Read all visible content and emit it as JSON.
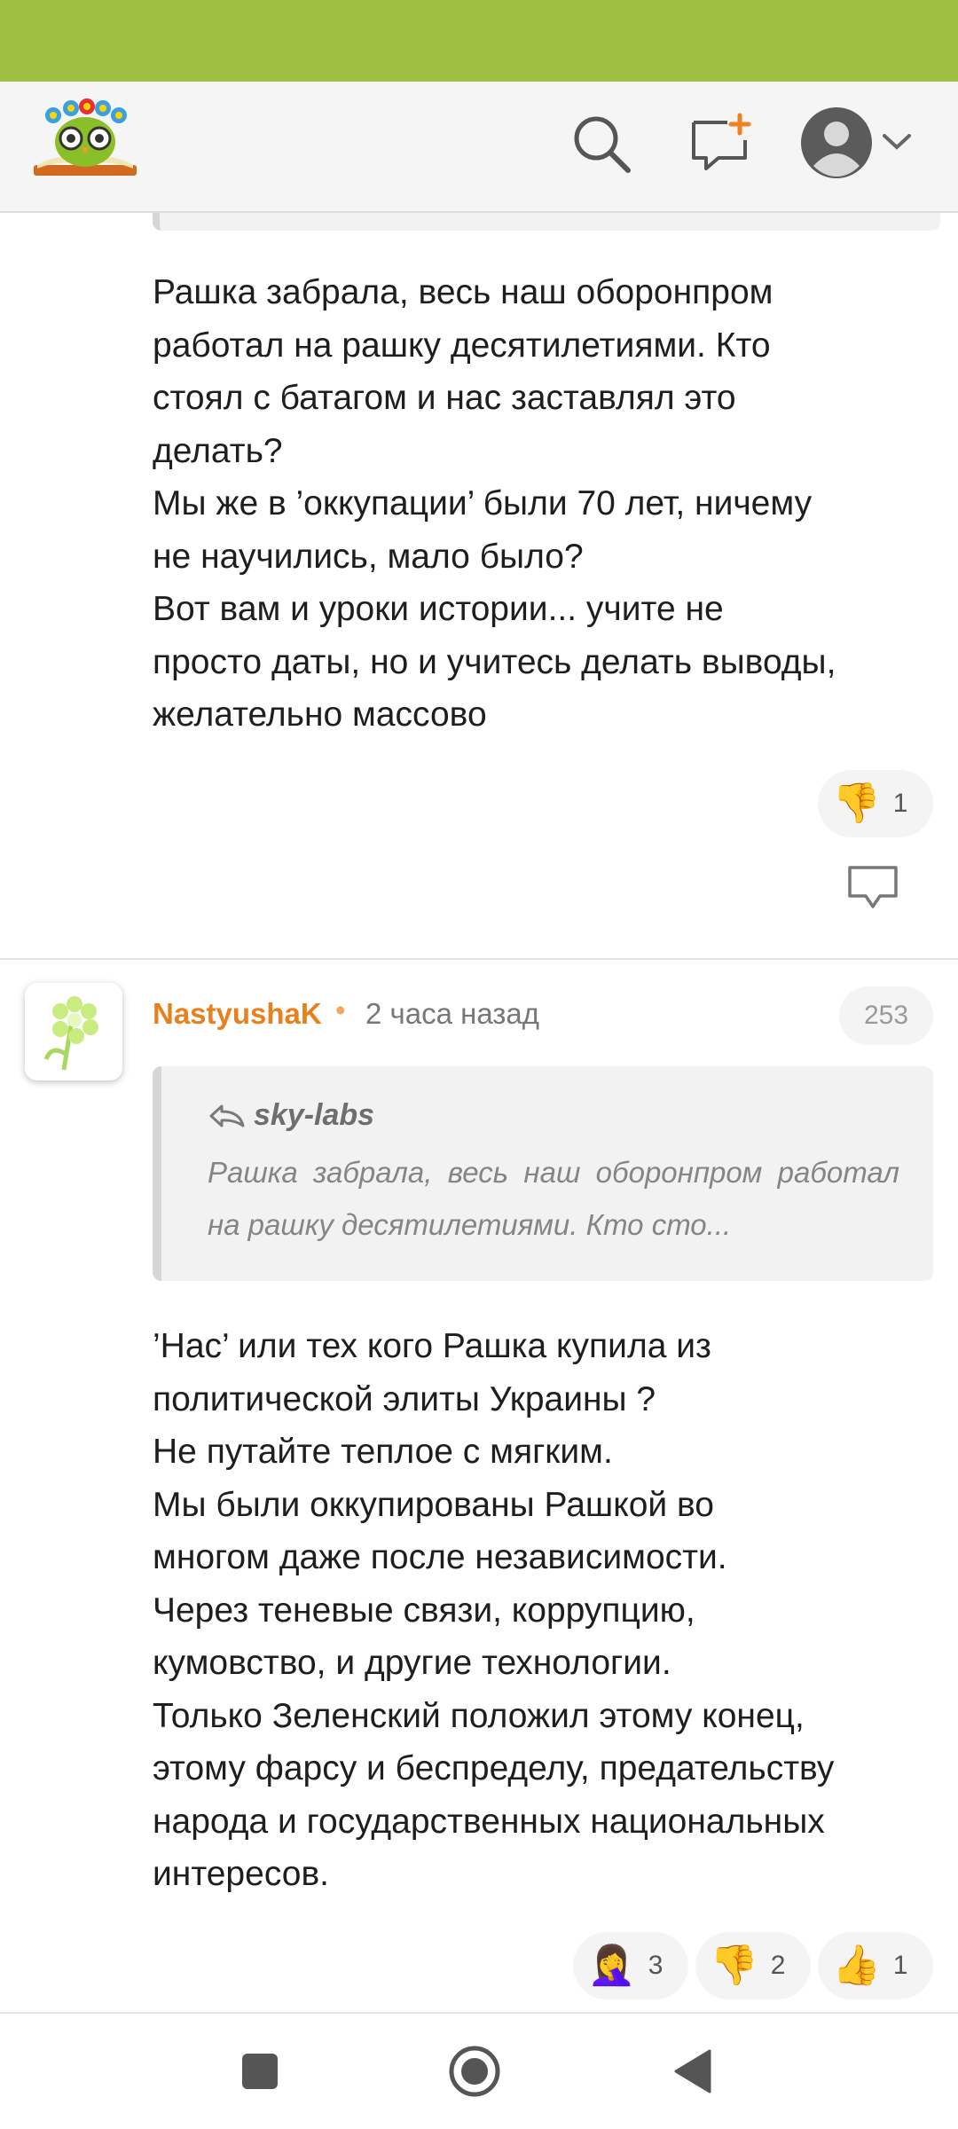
{
  "header": {
    "logo_icon": "owl-on-book-logo",
    "search_icon": "search-icon",
    "new_post_icon": "new-comment-icon",
    "profile_icon": "user-avatar-icon"
  },
  "comment_top": {
    "text": "Рашка забрала, весь наш оборонпром\nработал на рашку десятилетиями. Кто\nстоял с батагом и нас заставлял это\nделать?\nМы же в ’оккупации’ были 70 лет, ничему\nне научились, мало было?\nВот вам и уроки истории... учите не\nпросто даты, но и учитесь делать выводы,\nжелательно массово",
    "reactions": [
      {
        "emoji": "👎",
        "count": "1"
      }
    ]
  },
  "comment_2": {
    "author": "NastyushaK",
    "separator": "•",
    "time": "2 часа назад",
    "rating": "253",
    "quote": {
      "author": "sky-labs",
      "text": "Рашка забрала, весь наш оборонпром работал на рашку десятилетиями. Кто сто..."
    },
    "text": "’Нас’ или тех кого Рашка купила из\nполитической элиты Украины ?\nНе путайте теплое с мягким.\nМы были оккупированы Рашкой во\nмногом даже после независимости.\nЧерез теневые связи, коррупцию,\nкумовство, и другие технологии.\nТолько Зеленский положил этому конец,\nэтому фарсу и беспределу, предательству\nнарода и государственных национальных\nинтересов.",
    "reactions": [
      {
        "emoji": "🤦‍♀️",
        "count": "3"
      },
      {
        "emoji": "👎",
        "count": "2"
      },
      {
        "emoji": "👍",
        "count": "1"
      }
    ]
  },
  "colors": {
    "status_bar": "#9dc043",
    "author": "#e8801e"
  }
}
